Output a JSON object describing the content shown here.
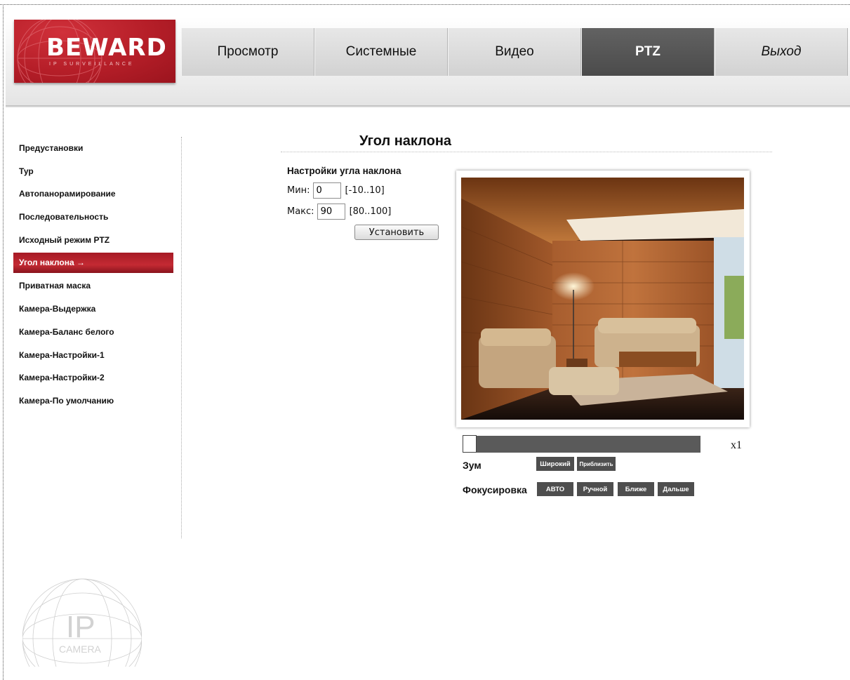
{
  "brand": {
    "name": "BEWARD",
    "tagline": "IP SURVEILLANCE",
    "accent": "#b51e28"
  },
  "nav": {
    "tabs": [
      {
        "label": "Просмотр",
        "active": false
      },
      {
        "label": "Системные",
        "active": false
      },
      {
        "label": "Видео",
        "active": false
      },
      {
        "label": "PTZ",
        "active": true
      },
      {
        "label": "Выход",
        "active": false
      }
    ]
  },
  "sidebar": {
    "items": [
      {
        "label": "Предустановки"
      },
      {
        "label": "Тур"
      },
      {
        "label": "Автопанорамирование"
      },
      {
        "label": "Последовательность"
      },
      {
        "label": "Исходный режим PTZ"
      },
      {
        "label": "Угол наклона",
        "active": true,
        "marker": "→"
      },
      {
        "label": "Приватная маска"
      },
      {
        "label": "Камера-Выдержка"
      },
      {
        "label": "Камера-Баланс белого"
      },
      {
        "label": "Камера-Настройки-1"
      },
      {
        "label": "Камера-Настройки-2"
      },
      {
        "label": "Камера-По умолчанию"
      }
    ]
  },
  "main": {
    "title": "Угол наклона",
    "form": {
      "heading": "Настройки угла наклона",
      "min": {
        "label": "Мин:",
        "value": "0",
        "range": "[-10..10]"
      },
      "max": {
        "label": "Макс:",
        "value": "90",
        "range": "[80..100]"
      },
      "submit_label": "Установить"
    }
  },
  "ptz": {
    "zoom_level": "x1",
    "zoom_fraction": 0,
    "zoom_label": "Зум",
    "zoom_buttons": [
      "Широкий",
      "Приблизить"
    ],
    "focus_label": "Фокусировка",
    "focus_buttons": [
      "АВТО",
      "Ручной",
      "Ближе",
      "Дальше"
    ]
  },
  "footer_logo": {
    "big": "IP",
    "small": "CAMERA"
  }
}
